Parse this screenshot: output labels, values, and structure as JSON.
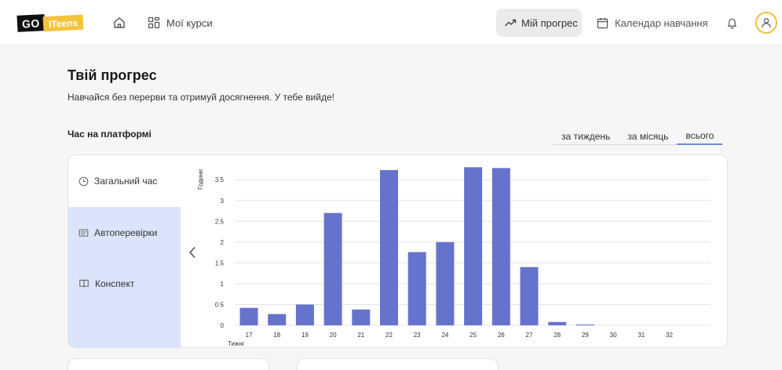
{
  "header": {
    "logo": {
      "part1": "GO",
      "part2": "ITeens"
    },
    "nav": {
      "courses_label": "Мої курси",
      "progress_label": "Мій прогрес",
      "calendar_label": "Календар навчання"
    },
    "icons": {
      "home": "home-icon",
      "courses": "grid-icon",
      "progress": "trending-up-icon",
      "calendar": "calendar-icon",
      "bell": "bell-icon",
      "avatar": "user-icon"
    },
    "accent_color": "#f0c040"
  },
  "main": {
    "title": "Твій прогрес",
    "subtitle": "Навчайся без перерви та отримуй досягнення. У тебе вийде!",
    "section_title": "Час на платформі",
    "tabs": [
      {
        "label": "за тиждень",
        "active": false
      },
      {
        "label": "за місяць",
        "active": false
      },
      {
        "label": "всього",
        "active": true
      }
    ],
    "side_menu": [
      {
        "label": "Загальний час",
        "icon": "clock-icon",
        "active": false
      },
      {
        "label": "Автоперевірки",
        "icon": "monitor-icon",
        "active": true
      },
      {
        "label": "Конспект",
        "icon": "book-icon",
        "active": true
      }
    ],
    "active_color": "#dbe4fa"
  },
  "chart_data": {
    "type": "bar",
    "categories": [
      "17",
      "18",
      "19",
      "20",
      "21",
      "22",
      "23",
      "24",
      "25",
      "26",
      "27",
      "28",
      "29",
      "30",
      "31",
      "32"
    ],
    "values": [
      0.42,
      0.27,
      0.5,
      2.7,
      0.38,
      3.73,
      1.76,
      2.0,
      3.8,
      3.78,
      1.4,
      0.08,
      0.02,
      0.0,
      0.0,
      0.0
    ],
    "xlabel": "Тижні",
    "ylabel": "Години",
    "ylim": [
      0,
      3.9
    ],
    "yticks": [
      "0",
      "0.5",
      "1",
      "1.5",
      "2",
      "2.5",
      "3",
      "3.5"
    ],
    "bar_color": "#6673cc",
    "grid": true
  }
}
